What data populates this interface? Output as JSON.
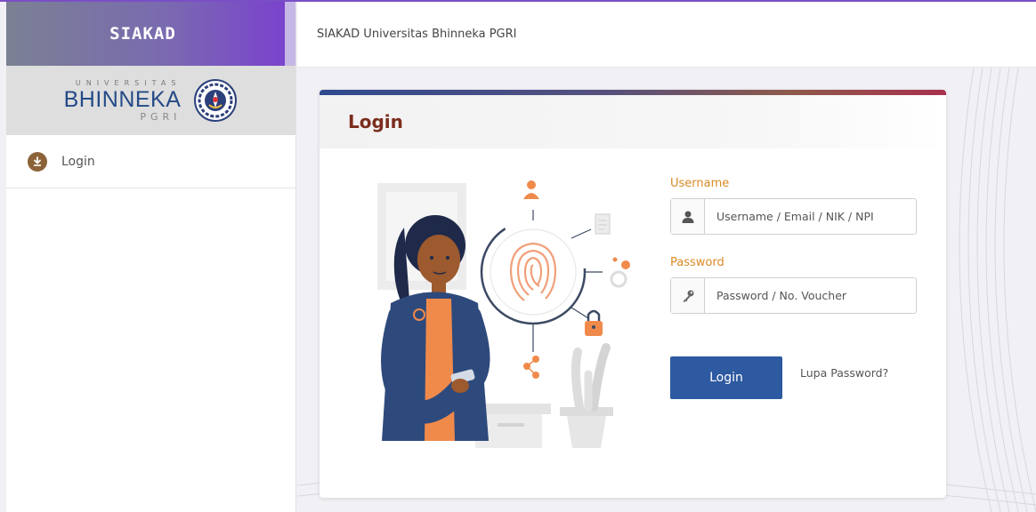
{
  "brand": {
    "title": "SIAKAD"
  },
  "logo": {
    "univ_text": "UNIVERSITAS",
    "name": "BHINNEKA",
    "sub": "PGRI"
  },
  "sidebar": {
    "items": [
      {
        "label": "Login",
        "icon": "download-circle-icon"
      }
    ]
  },
  "header": {
    "title": "SIAKAD Universitas Bhinneka PGRI"
  },
  "card": {
    "title": "Login"
  },
  "form": {
    "username_label": "Username",
    "username_placeholder": "Username / Email / NIK / NPI",
    "password_label": "Password",
    "password_placeholder": "Password / No. Voucher",
    "login_button": "Login",
    "forgot_link": "Lupa Password?"
  },
  "colors": {
    "accent_orange": "#d98a26",
    "button_blue": "#2d5aa0",
    "title_brown": "#7b2d1d",
    "brand_purple": "#7a3fcf"
  }
}
